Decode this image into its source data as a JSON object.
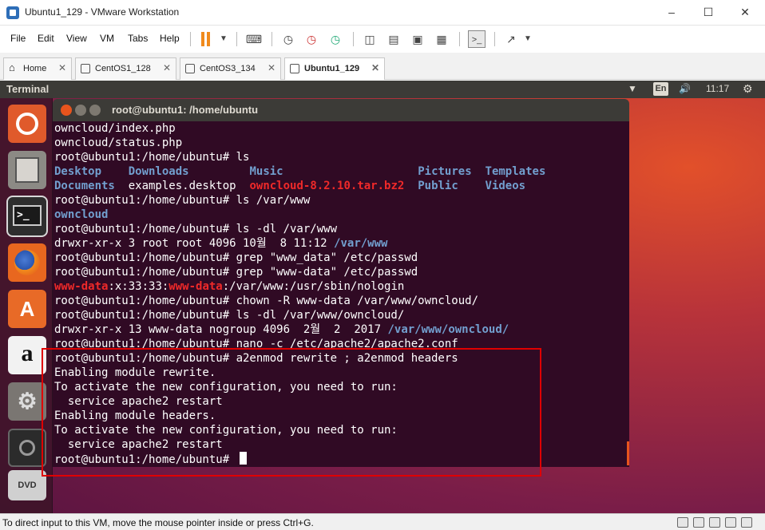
{
  "window": {
    "title": "Ubuntu1_129 - VMware Workstation"
  },
  "menu": [
    "File",
    "Edit",
    "View",
    "VM",
    "Tabs",
    "Help"
  ],
  "tabs": [
    {
      "label": "Home",
      "active": false
    },
    {
      "label": "CentOS1_128",
      "active": false
    },
    {
      "label": "CentOS3_134",
      "active": false
    },
    {
      "label": "Ubuntu1_129",
      "active": true
    }
  ],
  "ubuntu": {
    "topbar_title": "Terminal",
    "input_method": "En",
    "clock": "11:17"
  },
  "launcher": [
    "Ubuntu",
    "Files",
    "Terminal",
    "Firefox",
    "Software",
    "Amazon",
    "Settings",
    "Sound Recorder",
    "DVD"
  ],
  "terminal": {
    "title": "root@ubuntu1: /home/ubuntu",
    "lines": [
      [
        {
          "t": "owncloud/index.php"
        }
      ],
      [
        {
          "t": "owncloud/status.php"
        }
      ],
      [
        {
          "t": "root@ubuntu1:/home/ubuntu# ls"
        }
      ],
      [
        {
          "t": "Desktop",
          "c": "blue",
          "col": 0
        },
        {
          "t": "Downloads",
          "c": "blue",
          "col": 11
        },
        {
          "t": "Music",
          "c": "blue",
          "col": 29
        },
        {
          "t": "Pictures",
          "c": "blue",
          "col": 54
        },
        {
          "t": "Templates",
          "c": "blue",
          "col": 64
        }
      ],
      [
        {
          "t": "Documents",
          "c": "blue",
          "col": 0
        },
        {
          "t": "examples.desktop",
          "col": 11
        },
        {
          "t": "owncloud-8.2.10.tar.bz2",
          "c": "red",
          "col": 29
        },
        {
          "t": "Public",
          "c": "blue",
          "col": 54
        },
        {
          "t": "Videos",
          "c": "blue",
          "col": 64
        }
      ],
      [
        {
          "t": "root@ubuntu1:/home/ubuntu# ls /var/www"
        }
      ],
      [
        {
          "t": "owncloud",
          "c": "blue"
        }
      ],
      [
        {
          "t": "root@ubuntu1:/home/ubuntu# ls -dl /var/www"
        }
      ],
      [
        {
          "t": "drwxr-xr-x 3 root root 4096 10월  8 11:12 "
        },
        {
          "t": "/var/www",
          "c": "blue"
        }
      ],
      [
        {
          "t": "root@ubuntu1:/home/ubuntu# grep \"www_data\" /etc/passwd"
        }
      ],
      [
        {
          "t": "root@ubuntu1:/home/ubuntu# grep \"www-data\" /etc/passwd"
        }
      ],
      [
        {
          "t": "www-data",
          "c": "red"
        },
        {
          "t": ":x:33:33:"
        },
        {
          "t": "www-data",
          "c": "red"
        },
        {
          "t": ":/var/www:/usr/sbin/nologin"
        }
      ],
      [
        {
          "t": "root@ubuntu1:/home/ubuntu# chown -R www-data /var/www/owncloud/"
        }
      ],
      [
        {
          "t": "root@ubuntu1:/home/ubuntu# ls -dl /var/www/owncloud/"
        }
      ],
      [
        {
          "t": "drwxr-xr-x 13 www-data nogroup 4096  2월  2  2017 "
        },
        {
          "t": "/var/www/owncloud/",
          "c": "blue"
        }
      ],
      [
        {
          "t": "root@ubuntu1:/home/ubuntu# nano -c /etc/apache2/apache2.conf"
        }
      ],
      [
        {
          "t": "root@ubuntu1:/home/ubuntu# a2enmod rewrite ; a2enmod headers"
        }
      ],
      [
        {
          "t": "Enabling module rewrite."
        }
      ],
      [
        {
          "t": "To activate the new configuration, you need to run:"
        }
      ],
      [
        {
          "t": "  service apache2 restart"
        }
      ],
      [
        {
          "t": "Enabling module headers."
        }
      ],
      [
        {
          "t": "To activate the new configuration, you need to run:"
        }
      ],
      [
        {
          "t": "  service apache2 restart"
        }
      ],
      [
        {
          "t": "root@ubuntu1:/home/ubuntu# "
        }
      ]
    ]
  },
  "statusbar": {
    "text": "To direct input to this VM, move the mouse pointer inside or press Ctrl+G."
  },
  "colors": {
    "terminal_bg": "#300a24",
    "ls_dir": "#729fcf",
    "ls_archive": "#ef2929",
    "highlight": "#e00000"
  }
}
